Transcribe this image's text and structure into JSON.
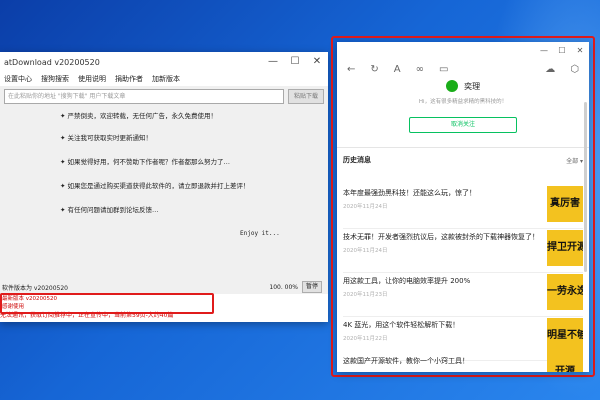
{
  "left_window": {
    "title": "atDownload v20200520",
    "controls": [
      "—",
      "☐",
      "✕"
    ],
    "menu": [
      "设置中心",
      "搜狗搜索",
      "使用说明",
      "捐助作者",
      "加新版本"
    ],
    "url_placeholder": "在此粘贴你的地址 \"搜狗下载\" 用户下载文章",
    "download_button": "粘贴下载",
    "notices": [
      "✦ 严禁倒卖，欢迎转载，无任何广告，永久免费使用！",
      "✦ 关注我可获取实时更新通知！",
      "✦ 如果觉得好用，何不赞助下作者呢？作者都那么努力了…",
      "✦ 如果您是通过购买渠道获得此软件的，请立即退款并打上差评！",
      "✦ 有任何问题请加群到论坛反馈…"
    ],
    "enjoy_text": "Enjoy it...",
    "status_left": "软件版本为 v20200520",
    "progress": "100. 00%",
    "stop_button": "暂停",
    "log_lines": [
      "最新版本 v20200520",
      "感谢使用"
    ],
    "log_highlight": "无法通讯，获取订阅推荐中，正在宣传中，当前第59页-大约40篇"
  },
  "right_window": {
    "controls": [
      "—",
      "☐",
      "✕"
    ],
    "toolbar_icons": [
      "back-icon",
      "refresh-icon",
      "font-icon",
      "link-icon",
      "window-icon",
      "cloud-icon",
      "settings-icon"
    ],
    "account_name": "奕理",
    "account_desc": "Hi，这有很多精益求精的黑科技的！",
    "follow_button": "取消关注",
    "history_title": "历史消息",
    "history_all": "全部 ▾",
    "articles": [
      {
        "title": "本年度最强劲黑科技！还能这么玩，惊了！",
        "date": "2020年11月24日",
        "thumb": "真厉害"
      },
      {
        "title": "技术无罪！开发者强烈抗议后，这款被封杀的下载神器恢复了！",
        "date": "2020年11月24日",
        "thumb": "捍卫开源"
      },
      {
        "title": "用这款工具，让你的电脑效率提升 200%",
        "date": "2020年11月23日",
        "thumb": "一劳永逸"
      },
      {
        "title": "4K 蓝光，用这个软件轻松解析下载！",
        "date": "2020年11月22日",
        "thumb": "明星不够"
      },
      {
        "title": "这款国产开源软件，教你一个小窍工具！",
        "date": "",
        "thumb": "开源"
      }
    ],
    "accent_color": "#07c160",
    "thumb_color": "#f3c21f"
  }
}
